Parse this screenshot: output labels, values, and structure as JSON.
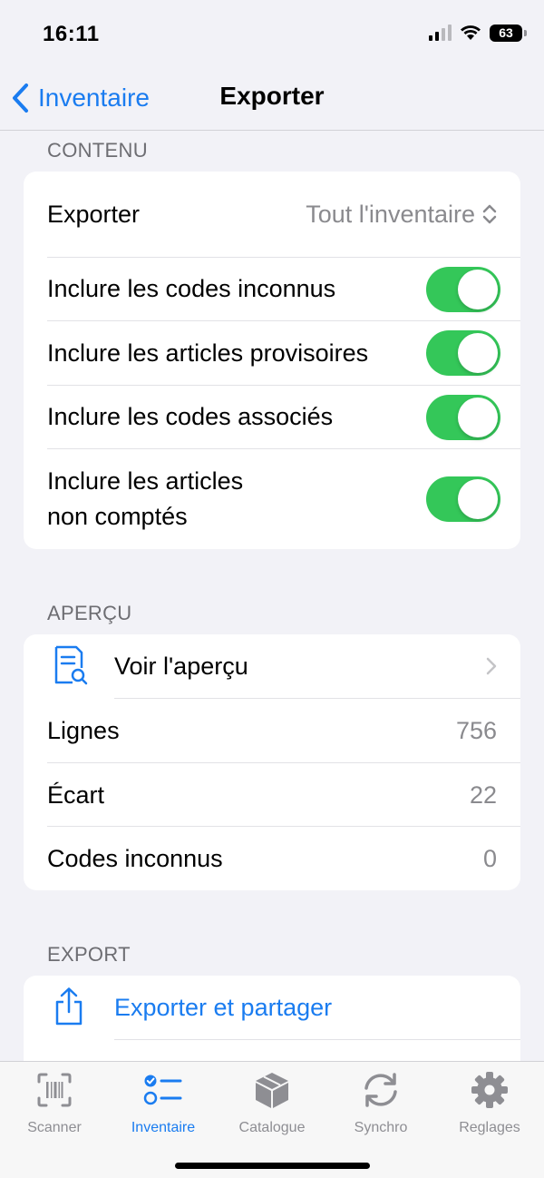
{
  "status_bar": {
    "time": "16:11",
    "battery": "63"
  },
  "nav": {
    "back_label": "Inventaire",
    "title": "Exporter"
  },
  "sections": {
    "contenu": {
      "header": "CONTENU",
      "export_label": "Exporter",
      "export_value": "Tout l'inventaire",
      "toggles": [
        {
          "label": "Inclure les codes inconnus",
          "on": true
        },
        {
          "label": "Inclure les articles provisoires",
          "on": true
        },
        {
          "label": "Inclure les codes associés",
          "on": true
        },
        {
          "label_line1": "Inclure les articles",
          "label_line2": "non comptés",
          "on": true
        }
      ]
    },
    "apercu": {
      "header": "APERÇU",
      "preview_label": "Voir l'aperçu",
      "rows": [
        {
          "label": "Lignes",
          "value": "756"
        },
        {
          "label": "Écart",
          "value": "22"
        },
        {
          "label": "Codes inconnus",
          "value": "0"
        }
      ]
    },
    "export": {
      "header": "EXPORT",
      "share_label": "Exporter et partager"
    }
  },
  "tabs": [
    {
      "label": "Scanner",
      "icon": "barcode-scan-icon",
      "active": false
    },
    {
      "label": "Inventaire",
      "icon": "checklist-icon",
      "active": true
    },
    {
      "label": "Catalogue",
      "icon": "box-icon",
      "active": false
    },
    {
      "label": "Synchro",
      "icon": "sync-icon",
      "active": false
    },
    {
      "label": "Reglages",
      "icon": "gear-icon",
      "active": false
    }
  ],
  "colors": {
    "accent": "#1a7cf0",
    "toggle_on": "#34c759",
    "background": "#f2f2f7"
  }
}
